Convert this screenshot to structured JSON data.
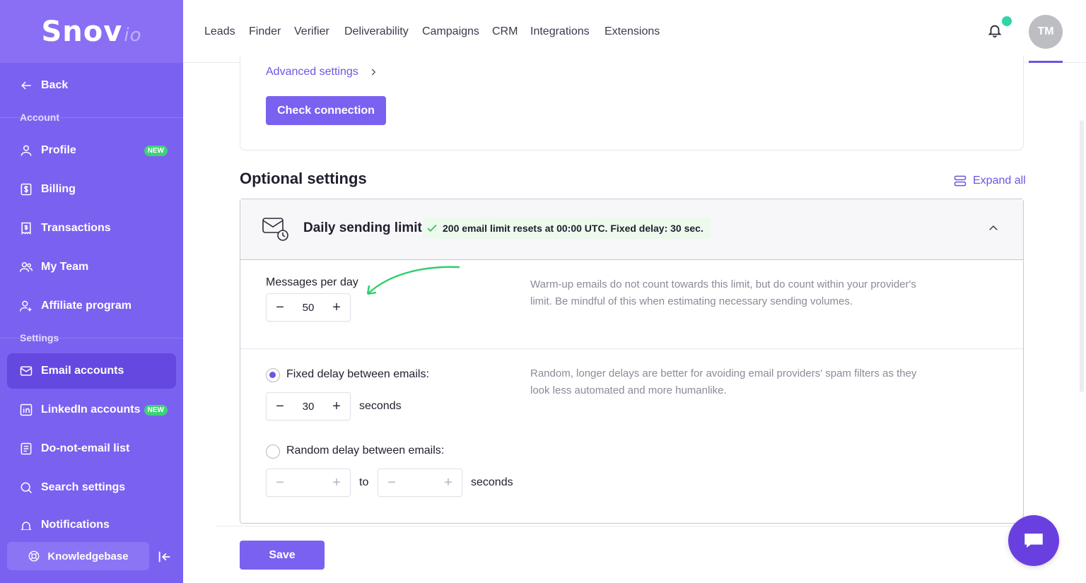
{
  "brand": {
    "name": "Snov",
    "suffix": "io"
  },
  "sidebar": {
    "back_label": "Back",
    "account_section": "Account",
    "settings_section": "Settings",
    "items": [
      {
        "label": "Profile",
        "icon": "user-icon",
        "badge": "NEW"
      },
      {
        "label": "Billing",
        "icon": "dollar-icon"
      },
      {
        "label": "Transactions",
        "icon": "receipt-icon"
      },
      {
        "label": "My Team",
        "icon": "team-icon"
      },
      {
        "label": "Affiliate program",
        "icon": "user-plus-icon"
      },
      {
        "label": "Email accounts",
        "icon": "mail-icon",
        "active": true
      },
      {
        "label": "LinkedIn accounts",
        "icon": "linkedin-icon",
        "badge": "NEW"
      },
      {
        "label": "Do-not-email list",
        "icon": "list-icon"
      },
      {
        "label": "Search settings",
        "icon": "search-icon"
      },
      {
        "label": "Notifications",
        "icon": "bell-icon"
      }
    ],
    "knowledgebase_label": "Knowledgebase"
  },
  "topnav": {
    "items": [
      "Leads",
      "Finder",
      "Verifier",
      "Deliverability",
      "Campaigns",
      "CRM",
      "Integrations",
      "Extensions"
    ],
    "avatar_initials": "TM"
  },
  "main": {
    "advanced_settings_link": "Advanced settings",
    "check_connection_label": "Check connection",
    "optional_settings_title": "Optional settings",
    "expand_all_label": "Expand all",
    "daily_limit": {
      "title": "Daily sending limit",
      "status": "200 email limit resets at 00:00 UTC. Fixed delay: 30 sec.",
      "messages_per_day_label": "Messages per day",
      "messages_per_day_value": "50",
      "messages_help": "Warm-up emails do not count towards this limit, but do count within your provider's limit. Be mindful of this when estimating necessary sending volumes.",
      "fixed_delay_label": "Fixed delay between emails:",
      "fixed_delay_value": "30",
      "seconds_label": "seconds",
      "delay_help": "Random, longer delays are better for avoiding email providers' spam filters as they look less automated and more humanlike.",
      "random_delay_label": "Random delay between emails:",
      "to_label": "to",
      "random_from_value": "",
      "random_to_value": ""
    },
    "save_label": "Save"
  },
  "colors": {
    "sidebar": "#7b61f0",
    "accent": "#6d55e0",
    "success": "#3bbf5a",
    "notification_dot": "#2ed5a9"
  }
}
